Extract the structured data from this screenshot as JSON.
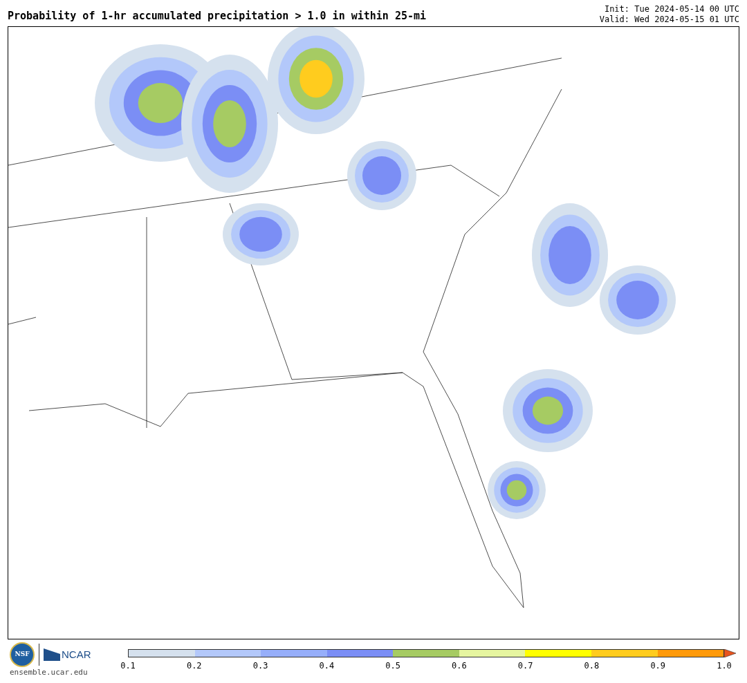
{
  "title": "Probability of 1-hr accumulated precipitation > 1.0 in within 25-mi",
  "init": "Init: Tue 2024-05-14 00 UTC",
  "valid": "Valid: Wed 2024-05-15 01 UTC",
  "logo": {
    "nsf": "NSF",
    "ncar": "NCAR",
    "site": "ensemble.ucar.edu"
  },
  "colorbar": {
    "segments": [
      {
        "color": "#d5e1ee"
      },
      {
        "color": "#b3c8fa"
      },
      {
        "color": "#96aefa"
      },
      {
        "color": "#7b8ef5"
      },
      {
        "color": "#a6cb63"
      },
      {
        "color": "#e6f5a0"
      },
      {
        "color": "#ffff00"
      },
      {
        "color": "#ffcc1e"
      },
      {
        "color": "#ff9a0a"
      }
    ],
    "extension": {
      "color": "#e8541e"
    },
    "labels": [
      "0.1",
      "0.2",
      "0.3",
      "0.4",
      "0.5",
      "0.6",
      "0.7",
      "0.8",
      "0.9",
      "1.0"
    ]
  }
}
